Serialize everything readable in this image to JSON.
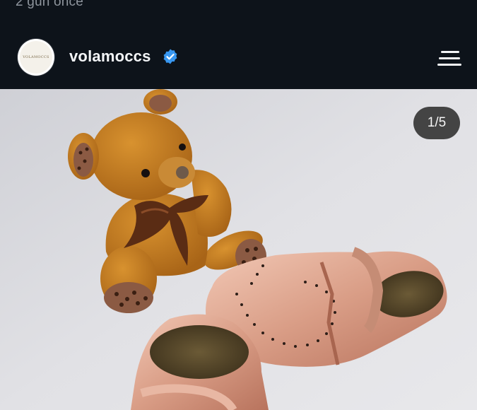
{
  "previous_post": {
    "caption": "2 gün önce"
  },
  "post": {
    "username": "volamoccs",
    "verified": true,
    "avatar": {
      "logo_text": "VOLAMOCCS"
    },
    "media": {
      "current_index": 1,
      "total": 5,
      "counter_text": "1/5"
    }
  },
  "icons": {
    "verified": "verified-badge-icon",
    "menu": "menu-icon"
  },
  "colors": {
    "background": "#0d131a",
    "text_primary": "#f3f5f7",
    "text_secondary": "#8e959d",
    "verified_blue": "#3897f0"
  }
}
